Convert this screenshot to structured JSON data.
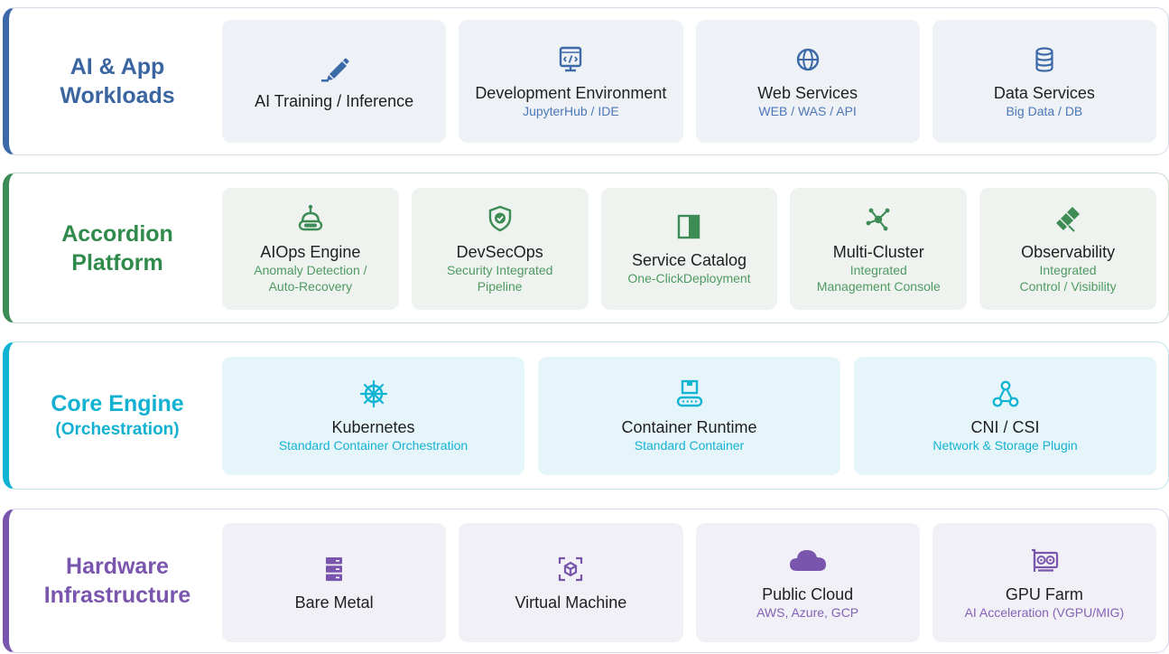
{
  "colors": {
    "workloads": "#3c6aa8",
    "platform": "#3d8c55",
    "core": "#12b4d4",
    "hardware": "#7a55ad"
  },
  "layers": {
    "ai": {
      "title_line1": "AI & App",
      "title_line2": "Workloads",
      "cards": [
        {
          "icon": "pencil-icon",
          "name": "AI Training / Inference",
          "sub": ""
        },
        {
          "icon": "code-window-icon",
          "name": "Development Environment",
          "sub": "JupyterHub / IDE"
        },
        {
          "icon": "globe-icon",
          "name": "Web Services",
          "sub": "WEB / WAS / API"
        },
        {
          "icon": "database-icon",
          "name": "Data Services",
          "sub": "Big Data / DB"
        }
      ]
    },
    "platform": {
      "title_line1": "Accordion",
      "title_line2": "Platform",
      "cards": [
        {
          "icon": "robot-icon",
          "name": "AIOps Engine",
          "sub1": "Anomaly Detection /",
          "sub2": "Auto-Recovery"
        },
        {
          "icon": "shield-check-icon",
          "name": "DevSecOps",
          "sub1": "Security Integrated",
          "sub2": "Pipeline"
        },
        {
          "icon": "book-icon",
          "name": "Service Catalog",
          "sub1": "One-ClickDeployment",
          "sub2": ""
        },
        {
          "icon": "network-nodes-icon",
          "name": "Multi-Cluster",
          "sub1": "Integrated",
          "sub2": "Management Console"
        },
        {
          "icon": "telescope-icon",
          "name": "Observability",
          "sub1": "Integrated",
          "sub2": "Control / Visibility"
        }
      ]
    },
    "core": {
      "title_line1": "Core Engine",
      "title_line2": "(Orchestration)",
      "cards": [
        {
          "icon": "helm-wheel-icon",
          "name": "Kubernetes",
          "sub": "Standard Container Orchestration"
        },
        {
          "icon": "conveyor-box-icon",
          "name": "Container Runtime",
          "sub": "Standard Container"
        },
        {
          "icon": "graph-nodes-icon",
          "name": "CNI / CSI",
          "sub": "Network & Storage Plugin"
        }
      ]
    },
    "hw": {
      "title_line1": "Hardware",
      "title_line2": "Infrastructure",
      "cards": [
        {
          "icon": "server-icon",
          "name": "Bare Metal",
          "sub": ""
        },
        {
          "icon": "virtual-box-icon",
          "name": "Virtual Machine",
          "sub": ""
        },
        {
          "icon": "cloud-icon",
          "name": "Public Cloud",
          "sub": "AWS, Azure, GCP"
        },
        {
          "icon": "gpu-card-icon",
          "name": "GPU Farm",
          "sub": "AI Acceleration (VGPU/MIG)"
        }
      ]
    }
  }
}
